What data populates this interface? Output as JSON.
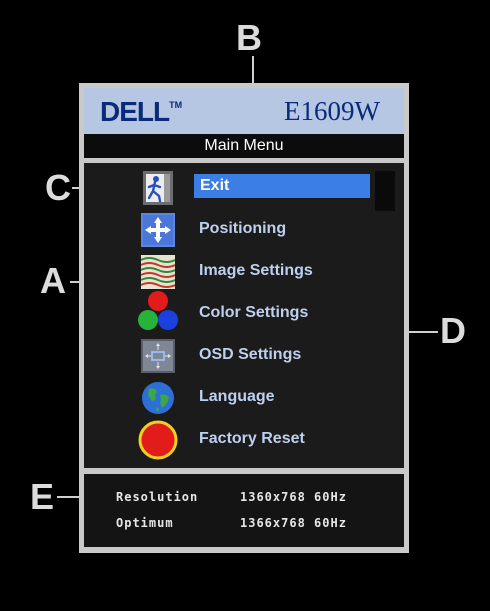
{
  "header": {
    "brand": "DELL",
    "trademark": "TM",
    "model": "E1609W"
  },
  "menu_title": "Main Menu",
  "menu": {
    "selected_index": 0,
    "items": [
      {
        "label": "Exit",
        "icon": "exit-icon"
      },
      {
        "label": "Positioning",
        "icon": "positioning-icon"
      },
      {
        "label": "Image Settings",
        "icon": "image-settings-icon"
      },
      {
        "label": "Color Settings",
        "icon": "color-settings-icon"
      },
      {
        "label": "OSD Settings",
        "icon": "osd-settings-icon"
      },
      {
        "label": "Language",
        "icon": "language-globe-icon"
      },
      {
        "label": "Factory Reset",
        "icon": "factory-reset-icon"
      }
    ]
  },
  "footer": {
    "rows": [
      {
        "label": "Resolution",
        "value": "1360x768 60Hz"
      },
      {
        "label": "Optimum",
        "value": "1366x768 60Hz"
      }
    ]
  },
  "callouts": {
    "a": "A",
    "b": "B",
    "c": "C",
    "d": "D",
    "e": "E"
  },
  "colors": {
    "header_bg": "#b5c7e3",
    "brand": "#0a2a7a",
    "label": "#bdd0ee",
    "selected_bg": "#3b7fe6"
  }
}
